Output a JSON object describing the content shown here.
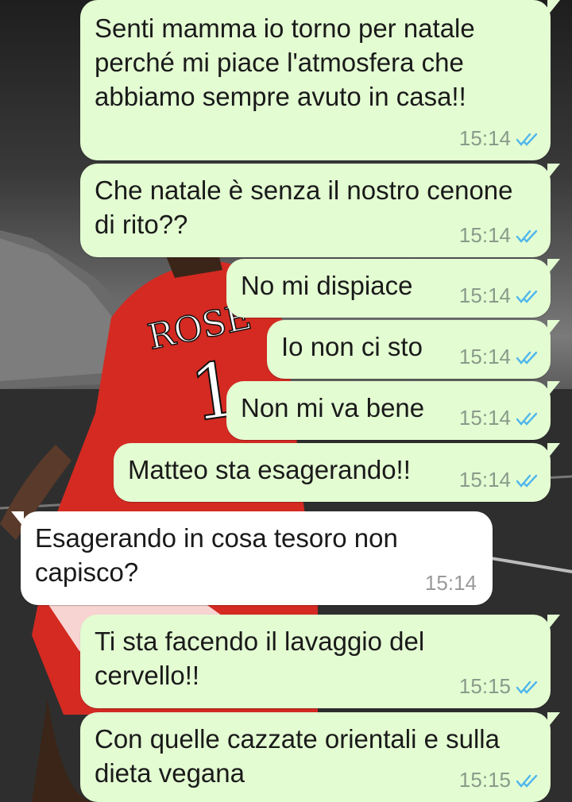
{
  "messages": [
    {
      "text": "Senti mamma io torno per natale perché mi piace l'atmosfera che abbiamo sempre avuto in casa!!",
      "time": "15:14",
      "direction": "outgoing",
      "status": "read"
    },
    {
      "text": "Che natale è senza il nostro cenone di rito??",
      "time": "15:14",
      "direction": "outgoing",
      "status": "read"
    },
    {
      "text": "No mi dispiace",
      "time": "15:14",
      "direction": "outgoing",
      "status": "read"
    },
    {
      "text": "Io non ci sto",
      "time": "15:14",
      "direction": "outgoing",
      "status": "read"
    },
    {
      "text": "Non mi va bene",
      "time": "15:14",
      "direction": "outgoing",
      "status": "read"
    },
    {
      "text": "Matteo sta esagerando!!",
      "time": "15:14",
      "direction": "outgoing",
      "status": "read"
    },
    {
      "text": "Esagerando in cosa tesoro non capisco?",
      "time": "15:14",
      "direction": "incoming"
    },
    {
      "text": "Ti sta facendo il lavaggio del cervello!!",
      "time": "15:15",
      "direction": "outgoing",
      "status": "read"
    },
    {
      "text": "Con quelle cazzate orientali e sulla dieta vegana",
      "time": "15:15",
      "direction": "outgoing",
      "status": "read"
    }
  ],
  "wallpaper": {
    "jersey_name": "ROSE",
    "jersey_number": "1",
    "jersey_color": "#d42a22"
  },
  "colors": {
    "outgoing_bubble": "#e3fcd2",
    "incoming_bubble": "#ffffff",
    "read_ticks": "#4fb6ec",
    "timestamp": "#8a9a8a"
  },
  "icons": {
    "read_status": "double-check-icon"
  }
}
